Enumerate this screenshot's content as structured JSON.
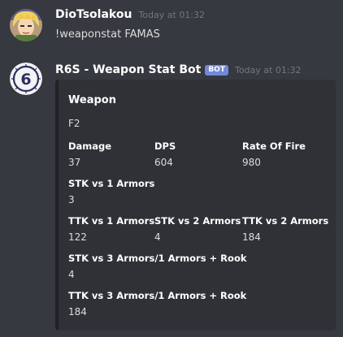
{
  "messages": [
    {
      "username": "DioTsolakou",
      "timestamp": "Today at 01:32",
      "content": "!weaponstat FAMAS",
      "avatar": "anime-character-avatar"
    },
    {
      "username": "R6S - Weapon Stat Bot",
      "bot_tag": "BOT",
      "timestamp": "Today at 01:32",
      "avatar": "rainbow-six-siege-logo"
    }
  ],
  "embed": {
    "title": "Weapon",
    "description": "F2",
    "fields": [
      {
        "name": "Damage",
        "value": "37"
      },
      {
        "name": "DPS",
        "value": "604"
      },
      {
        "name": "Rate Of Fire",
        "value": "980"
      },
      {
        "name": "STK vs 1 Armors",
        "value": "3"
      },
      {
        "name": "TTK vs 1 Armors",
        "value": "122"
      },
      {
        "name": "STK vs 2 Armors",
        "value": "4"
      },
      {
        "name": "TTK vs 2 Armors",
        "value": "184"
      },
      {
        "name": "STK vs 3 Armors/1 Armors + Rook",
        "value": "4"
      },
      {
        "name": "TTK vs 3 Armors/1 Armors + Rook",
        "value": "184"
      }
    ]
  },
  "colors": {
    "background": "#36393f",
    "embed_background": "#2f3136",
    "bot_tag": "#7289da"
  }
}
